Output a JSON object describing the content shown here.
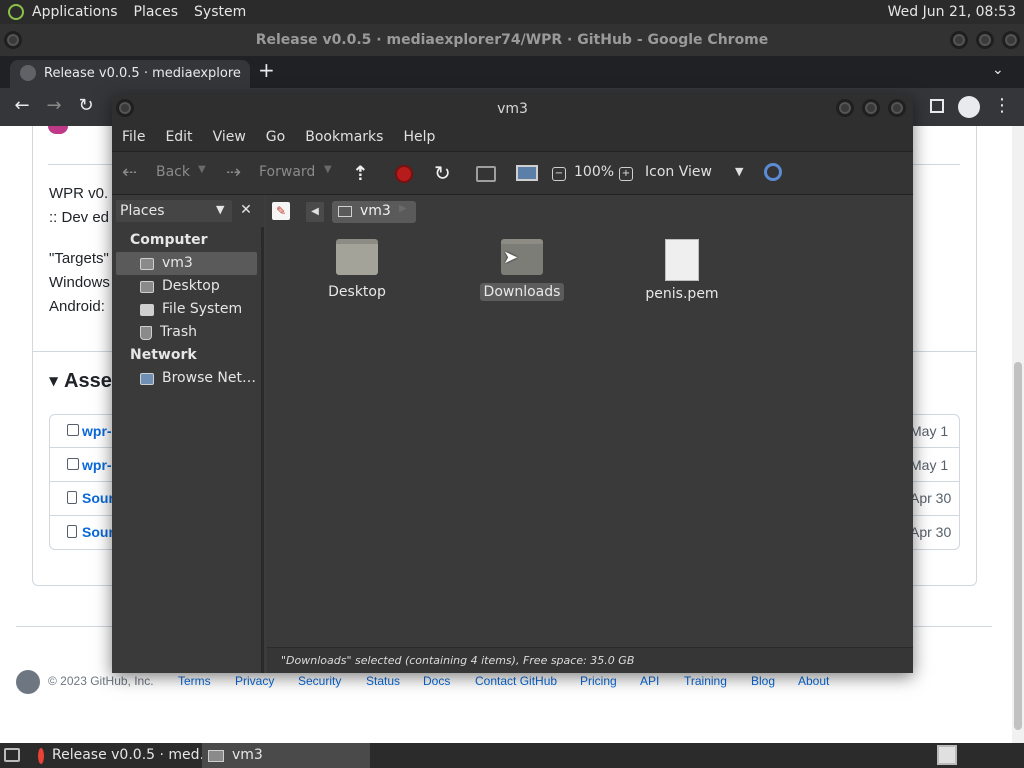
{
  "top_panel": {
    "menus": [
      "Applications",
      "Places",
      "System"
    ],
    "clock": "Wed Jun 21, 08:53"
  },
  "chrome": {
    "window_title": "Release v0.0.5 · mediaexplorer74/WPR · GitHub - Google Chrome",
    "tab_title": "Release v0.0.5 · mediaexplore",
    "new_tab": "+"
  },
  "github": {
    "body_line1": "WPR v0.",
    "body_line2": ":: Dev ed",
    "targets": "\"Targets\"",
    "windows": "Windows",
    "android": "Android:",
    "assets_heading": "Asse",
    "assets": [
      {
        "name": "wpr-",
        "date": "May 1"
      },
      {
        "name": "wpr-",
        "date": "May 1"
      },
      {
        "name": "Sour",
        "date": "Apr 30"
      },
      {
        "name": "Sour",
        "date": "Apr 30"
      }
    ],
    "footer_copyright": "© 2023 GitHub, Inc.",
    "footer_links": [
      "Terms",
      "Privacy",
      "Security",
      "Status",
      "Docs",
      "Contact GitHub",
      "Pricing",
      "API",
      "Training",
      "Blog",
      "About"
    ]
  },
  "nautilus": {
    "title": "vm3",
    "menu": [
      "File",
      "Edit",
      "View",
      "Go",
      "Bookmarks",
      "Help"
    ],
    "toolbar": {
      "back": "Back",
      "forward": "Forward",
      "zoom": "100%",
      "view_mode": "Icon View"
    },
    "sidebar_selector": "Places",
    "path_segment": "vm3",
    "sections": [
      {
        "heading": "Computer",
        "items": [
          {
            "label": "vm3",
            "icon": "home-icon",
            "selected": true
          },
          {
            "label": "Desktop",
            "icon": "desktop-icon",
            "selected": false
          },
          {
            "label": "File System",
            "icon": "drive-icon",
            "selected": false
          },
          {
            "label": "Trash",
            "icon": "trash-icon",
            "selected": false
          }
        ]
      },
      {
        "heading": "Network",
        "items": [
          {
            "label": "Browse Net…",
            "icon": "network-icon",
            "selected": false
          }
        ]
      }
    ],
    "files": [
      {
        "name": "Desktop",
        "kind": "folder",
        "selected": false
      },
      {
        "name": "Downloads",
        "kind": "folder",
        "selected": true
      },
      {
        "name": "penis.pem",
        "kind": "file",
        "selected": false
      }
    ],
    "status": "\"Downloads\" selected (containing 4 items), Free space: 35.0 GB"
  },
  "taskbar": {
    "tasks": [
      {
        "label": "Release v0.0.5 · med…",
        "active": false
      },
      {
        "label": "vm3",
        "active": true
      }
    ]
  }
}
